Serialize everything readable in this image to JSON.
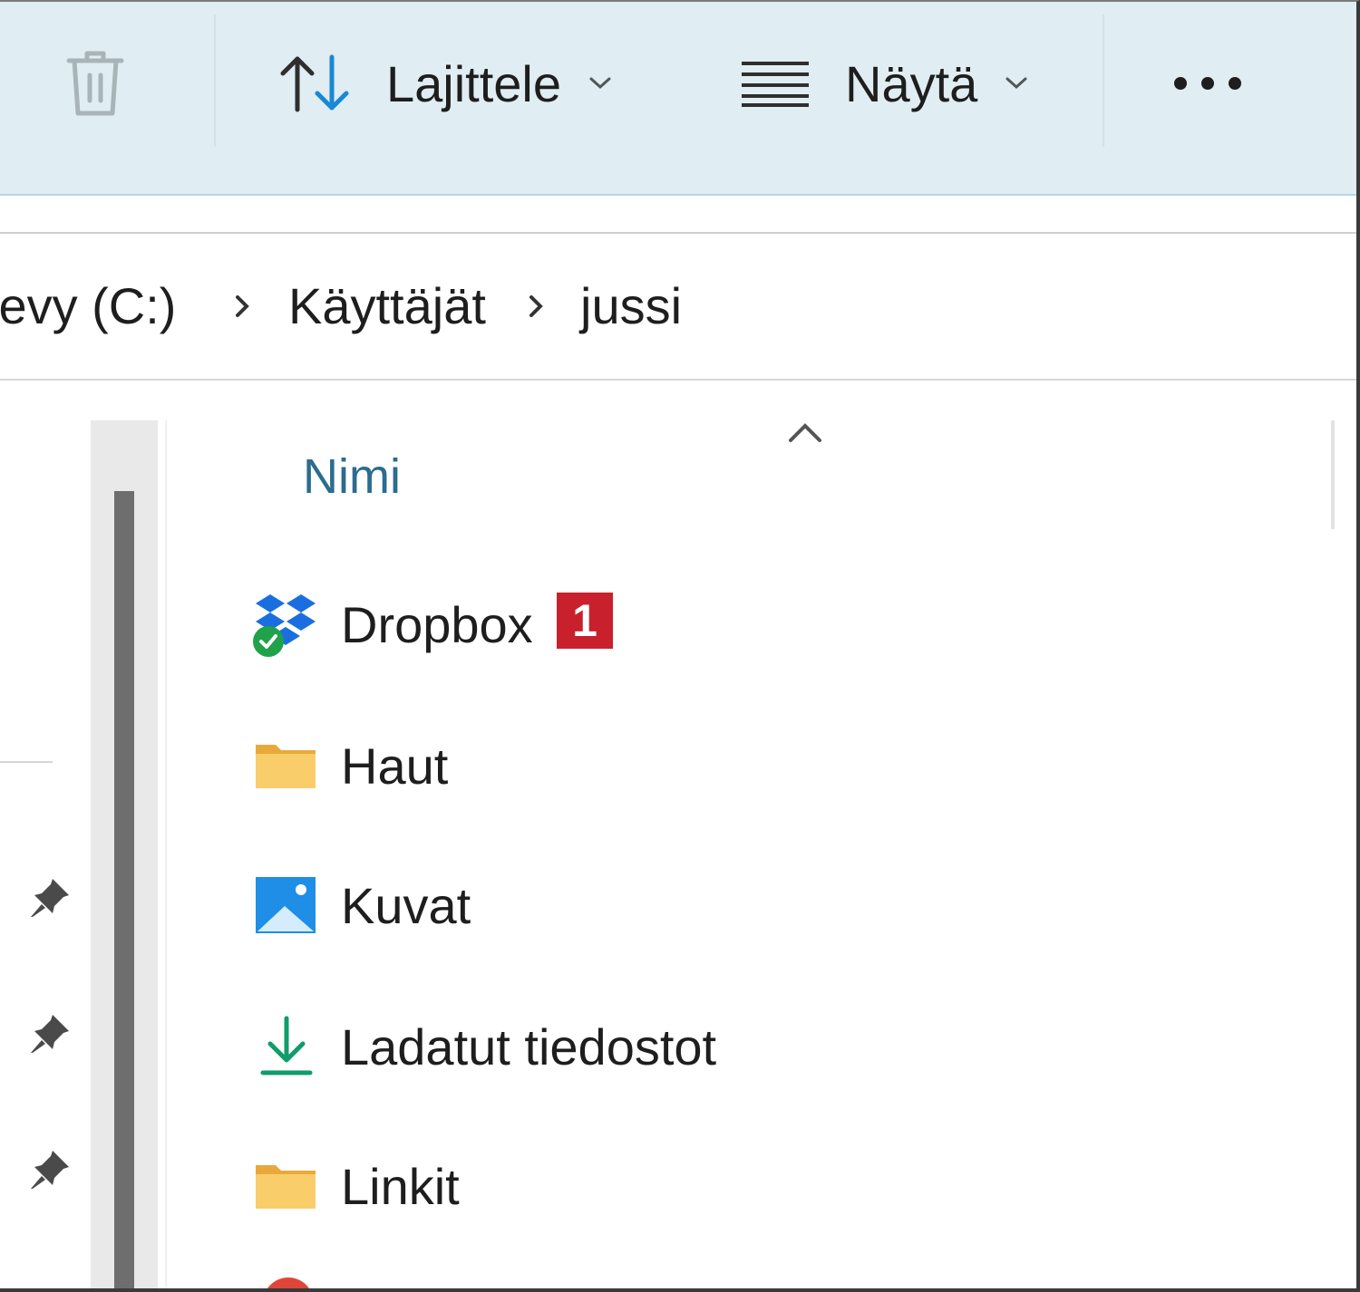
{
  "toolbar": {
    "delete_icon": "trash-icon",
    "sort_label": "Lajittele",
    "view_label": "Näytä",
    "more_icon": "more-ellipsis-icon",
    "sort_icon": "sort-arrows-icon",
    "view_icon": "view-list-icon",
    "accent_color": "#1a88d4"
  },
  "breadcrumb": {
    "items": [
      "levy (C:)",
      "Käyttäjät",
      "jussi"
    ],
    "separator_icon": "chevron-right-icon"
  },
  "columns": {
    "name_header": "Nimi",
    "sort_icon": "chevron-up-icon"
  },
  "files": [
    {
      "name": "Dropbox",
      "icon": "dropbox-icon",
      "badge": "1",
      "status_icon": "synced-check-icon"
    },
    {
      "name": "Haut",
      "icon": "folder-icon"
    },
    {
      "name": "Kuvat",
      "icon": "pictures-icon"
    },
    {
      "name": "Ladatut tiedostot",
      "icon": "download-icon"
    },
    {
      "name": "Linkit",
      "icon": "folder-icon"
    }
  ],
  "colors": {
    "toolbar_bg": "#e0edf2",
    "header_text": "#2b6c8f",
    "badge_red": "#c8202c",
    "folder_yellow": "#f7c25a",
    "download_green": "#0f9d6a",
    "check_green": "#1fa24a"
  }
}
